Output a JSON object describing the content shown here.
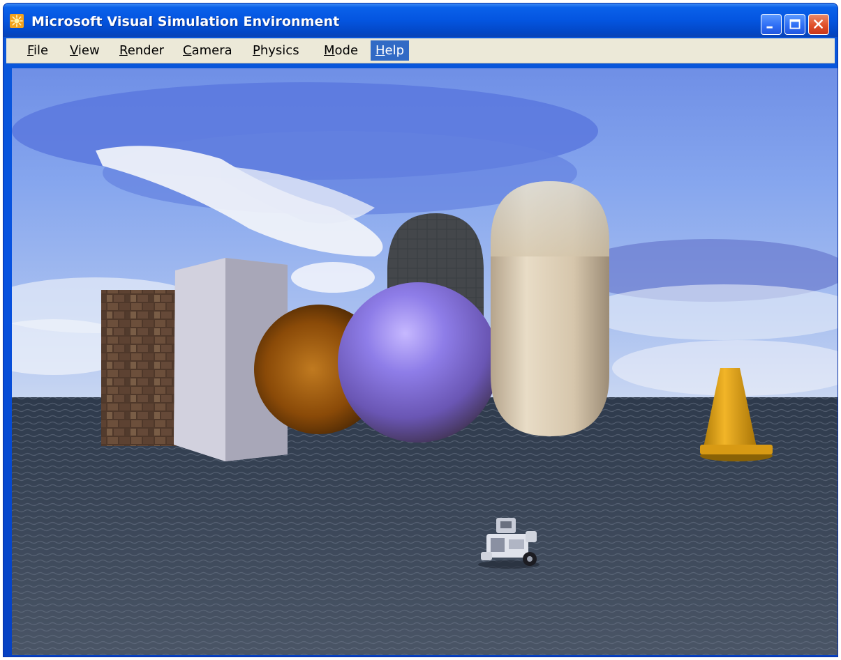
{
  "window": {
    "title": "Microsoft Visual Simulation Environment",
    "icon": "sun-app-icon",
    "controls": {
      "minimize": "minimize-icon",
      "maximize": "maximize-icon",
      "close": "close-icon"
    }
  },
  "menu": {
    "items": [
      {
        "accel": "F",
        "rest": "ile"
      },
      {
        "accel": "V",
        "rest": "iew"
      },
      {
        "accel": "R",
        "rest": "ender"
      },
      {
        "accel": "C",
        "rest": "amera"
      },
      {
        "accel": "P",
        "rest": "hysics"
      },
      {
        "accel": "M",
        "rest": "ode"
      },
      {
        "accel": "H",
        "rest": "elp"
      }
    ],
    "active_item": "Help"
  },
  "colors": {
    "titlebar": "#0455e0",
    "menu_background": "#ece9d8",
    "menu_highlight": "#316ac5"
  }
}
